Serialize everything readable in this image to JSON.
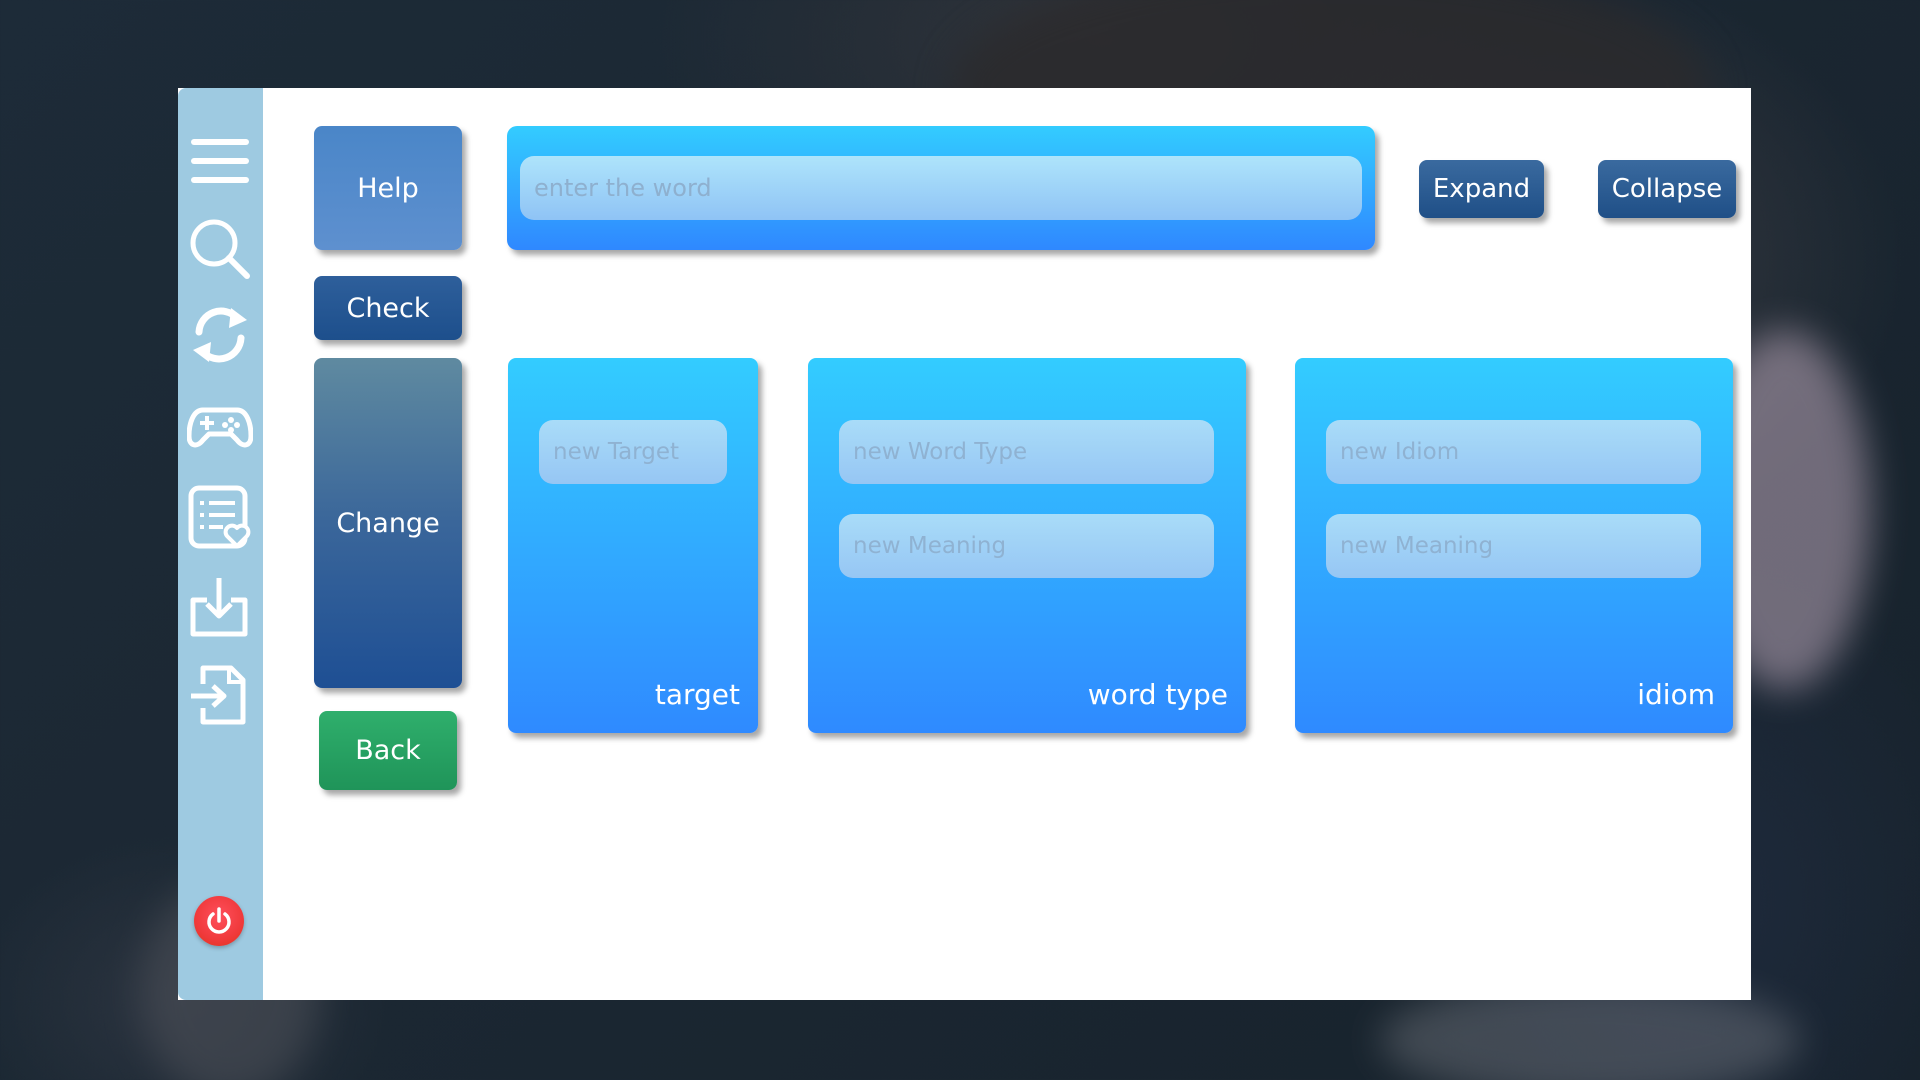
{
  "sidebar": {
    "icons": [
      {
        "name": "menu-icon"
      },
      {
        "name": "search-icon"
      },
      {
        "name": "refresh-icon"
      },
      {
        "name": "gamepad-icon"
      },
      {
        "name": "favorite-list-icon"
      },
      {
        "name": "download-icon"
      },
      {
        "name": "import-file-icon"
      }
    ],
    "power": {
      "name": "power-icon",
      "color": "#f03a3c"
    }
  },
  "buttons": {
    "help": "Help",
    "check": "Check",
    "change": "Change",
    "back": "Back",
    "expand": "Expand",
    "collapse": "Collapse"
  },
  "search": {
    "placeholder": "enter the word",
    "value": ""
  },
  "cards": {
    "target": {
      "label": "target",
      "input_placeholder": "new Target"
    },
    "word_type": {
      "label": "word type",
      "type_placeholder": "new Word Type",
      "meaning_placeholder": "new Meaning"
    },
    "idiom": {
      "label": "idiom",
      "idiom_placeholder": "new Idiom",
      "meaning_placeholder": "new Meaning"
    }
  },
  "colors": {
    "sidebar": "#9ecae1",
    "panel_top": "#33ccff",
    "panel_bottom": "#2f88ff",
    "back_button": "#2faf6c",
    "dark_button": "#1f4f87"
  }
}
